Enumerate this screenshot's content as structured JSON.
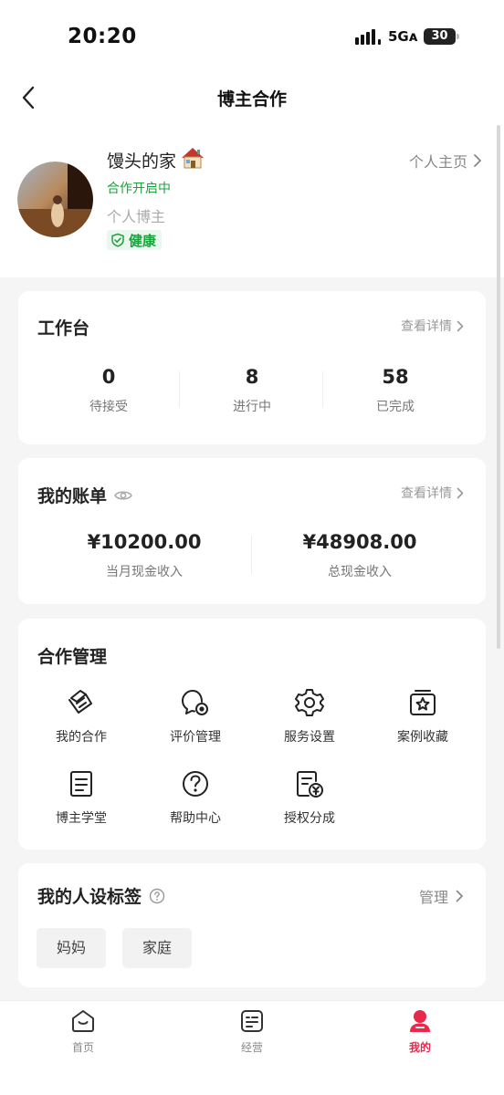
{
  "status_bar": {
    "time": "20:20",
    "network": "5Gᴀ",
    "battery": "30"
  },
  "nav": {
    "title": "博主合作"
  },
  "profile": {
    "name": "馒头的家",
    "coop_status": "合作开启中",
    "blogger_type": "个人博主",
    "health": "健康",
    "homepage_link": "个人主页"
  },
  "workbench": {
    "title": "工作台",
    "detail_link": "查看详情",
    "stats": [
      {
        "value": "0",
        "label": "待接受"
      },
      {
        "value": "8",
        "label": "进行中"
      },
      {
        "value": "58",
        "label": "已完成"
      }
    ]
  },
  "bill": {
    "title": "我的账单",
    "detail_link": "查看详情",
    "items": [
      {
        "value": "¥10200.00",
        "label": "当月现金收入"
      },
      {
        "value": "¥48908.00",
        "label": "总现金收入"
      }
    ]
  },
  "management": {
    "title": "合作管理",
    "tools": [
      {
        "label": "我的合作",
        "icon": "cooperation-icon"
      },
      {
        "label": "评价管理",
        "icon": "review-icon"
      },
      {
        "label": "服务设置",
        "icon": "gear-icon"
      },
      {
        "label": "案例收藏",
        "icon": "star-box-icon"
      },
      {
        "label": "博主学堂",
        "icon": "document-icon"
      },
      {
        "label": "帮助中心",
        "icon": "help-icon"
      },
      {
        "label": "授权分成",
        "icon": "revenue-share-icon"
      }
    ]
  },
  "tags": {
    "title": "我的人设标签",
    "manage_link": "管理",
    "items": [
      "妈妈",
      "家庭"
    ]
  },
  "tab_bar": {
    "tabs": [
      {
        "label": "首页",
        "icon": "home-icon",
        "active": false
      },
      {
        "label": "经营",
        "icon": "business-icon",
        "active": false
      },
      {
        "label": "我的",
        "icon": "profile-icon",
        "active": true
      }
    ]
  },
  "colors": {
    "accent": "#e8294b",
    "green": "#1aa33c"
  }
}
